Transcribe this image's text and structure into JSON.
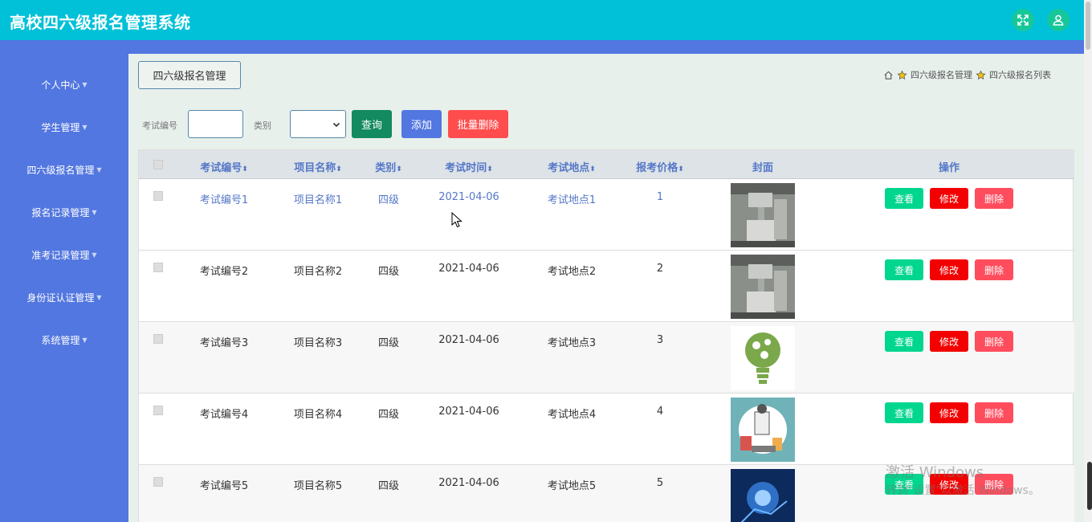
{
  "header": {
    "title": "高校四六级报名管理系统"
  },
  "sidebar": {
    "items": [
      {
        "label": "个人中心"
      },
      {
        "label": "学生管理"
      },
      {
        "label": "四六级报名管理"
      },
      {
        "label": "报名记录管理"
      },
      {
        "label": "准考记录管理"
      },
      {
        "label": "身份证认证管理"
      },
      {
        "label": "系统管理"
      }
    ]
  },
  "page_tab": {
    "label": "四六级报名管理"
  },
  "breadcrumb": {
    "items": [
      "四六级报名管理",
      "四六级报名列表"
    ]
  },
  "search": {
    "exam_no_label": "考试编号",
    "category_label": "类别",
    "query_label": "查询",
    "add_label": "添加",
    "batch_delete_label": "批量删除"
  },
  "table": {
    "columns": [
      "考试编号",
      "项目名称",
      "类别",
      "考试时间",
      "考试地点",
      "报考价格",
      "封面",
      "操作"
    ],
    "rows": [
      {
        "exam_no": "考试编号1",
        "project": "项目名称1",
        "category": "四级",
        "time": "2021-04-06",
        "place": "考试地点1",
        "price": "1",
        "cover": "machine"
      },
      {
        "exam_no": "考试编号2",
        "project": "项目名称2",
        "category": "四级",
        "time": "2021-04-06",
        "place": "考试地点2",
        "price": "2",
        "cover": "machine"
      },
      {
        "exam_no": "考试编号3",
        "project": "项目名称3",
        "category": "四级",
        "time": "2021-04-06",
        "place": "考试地点3",
        "price": "3",
        "cover": "lightbulb"
      },
      {
        "exam_no": "考试编号4",
        "project": "项目名称4",
        "category": "四级",
        "time": "2021-04-06",
        "place": "考试地点4",
        "price": "4",
        "cover": "scientist"
      },
      {
        "exam_no": "考试编号5",
        "project": "项目名称5",
        "category": "四级",
        "time": "2021-04-06",
        "place": "考试地点5",
        "price": "5",
        "cover": "blue-tech"
      }
    ],
    "actions": {
      "view": "查看",
      "edit": "修改",
      "delete": "删除"
    }
  },
  "watermark": {
    "line1": "激活 Windows",
    "line2": "转到\"设置\"以激活 Windows。"
  },
  "colors": {
    "header": "#00c1d8",
    "sidebar": "#5377e0",
    "view": "#00d68f",
    "edit": "#f30000",
    "delete": "#ff4d5e"
  }
}
